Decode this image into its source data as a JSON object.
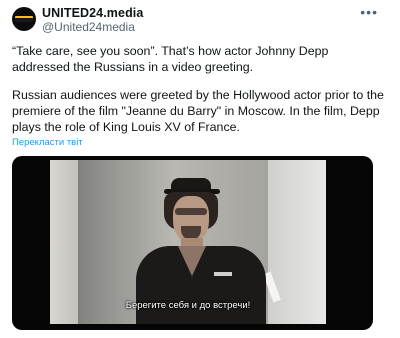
{
  "tweet": {
    "author_name": "UNITED24.media",
    "author_handle": "@United24media",
    "more_icon": "more-horizontal-icon",
    "paragraph_1": "“Take care, see you soon”. That’s how actor Johnny Depp addressed the Russians in a video greeting.",
    "paragraph_2": "Russian audiences were greeted by the Hollywood actor prior to the premiere of the film \"Jeanne du Barry\" in Moscow. In the film, Depp plays the role of King Louis XV of France.",
    "translate_label": "Перекласти твіт"
  },
  "media": {
    "subtitle": "Берегите себя и до встречи!"
  },
  "colors": {
    "link": "#1d9bf0",
    "secondary_text": "#536471",
    "primary_text": "#0f1419",
    "media_background": "#050505"
  }
}
